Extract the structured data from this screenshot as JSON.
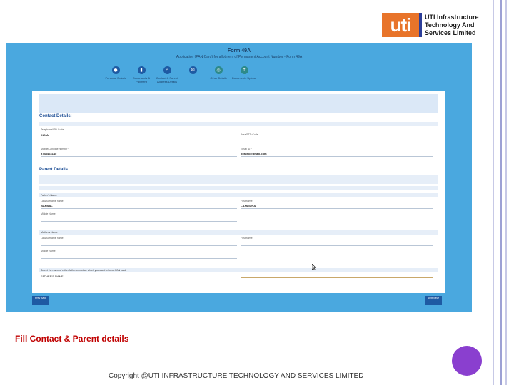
{
  "logo": {
    "mark": "uti",
    "line1": "UTI Infrastructure",
    "line2": "Technology And",
    "line3": "Services Limited"
  },
  "screenshot": {
    "form_title": "Form 49A",
    "form_subtitle": "Application (PAN Card) for allotment of Permanent Account Number - Form 49A",
    "steps": [
      {
        "label": "Personal Details",
        "icon": "person-icon"
      },
      {
        "label": "Documents & Payment",
        "icon": "document-icon"
      },
      {
        "label": "Contact & Parent Address Details",
        "icon": "address-icon"
      },
      {
        "label": "Other Details",
        "icon": "details-icon"
      },
      {
        "label": "Documents Upload",
        "icon": "upload-icon"
      }
    ],
    "contact_heading": "Contact Details:",
    "telephone_label": "Telephone/ISD Code",
    "telephone_value": "INDIA",
    "std_label": "Area/STD Code",
    "mobile_label": "Mobile/Landline number *",
    "mobile_value": "9748464145",
    "email_label": "Email ID *",
    "email_value": "deacto@gmail.com",
    "parent_heading": "Parent Details",
    "fathers_name_label": "Father's Name",
    "last_name_label": "Last/Surname name",
    "last_name_value": "BANSAL",
    "first_name_label": "First name",
    "first_name_value": "LAXMIDHA",
    "middle_name_label": "Middle Name",
    "mothers_name_label": "Mother's Name",
    "select_parent_label": "Select the name of either father or mother which you want to be on PAN card",
    "select_parent_value": "FATHER'S NAME",
    "prev_button": "Prev Back",
    "next_button": "Next Save"
  },
  "caption": "Fill Contact & Parent details",
  "footer": "Copyright @UTI INFRASTRUCTURE TECHNOLOGY AND SERVICES LIMITED",
  "colors": {
    "frame": "#4aa8df",
    "caption": "#c00000",
    "circle": "#8a3fcf",
    "logo_orange": "#e8742a"
  }
}
